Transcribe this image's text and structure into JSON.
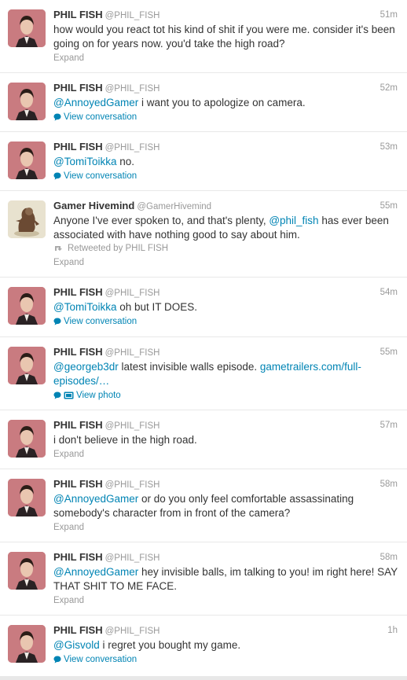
{
  "tweets": [
    {
      "kind": "phil",
      "name": "PHIL FISH",
      "handle": "@PHIL_FISH",
      "time": "51m",
      "mention": "",
      "text": "how would you react tot his kind of shit if you were me. consider it's been going on for years now. you'd take the high road?",
      "action": "Expand",
      "action_type": "expand"
    },
    {
      "kind": "phil",
      "name": "PHIL FISH",
      "handle": "@PHIL_FISH",
      "time": "52m",
      "mention": "@AnnoyedGamer",
      "text": " i want you to apologize on camera.",
      "action": "View conversation",
      "action_type": "conversation"
    },
    {
      "kind": "phil",
      "name": "PHIL FISH",
      "handle": "@PHIL_FISH",
      "time": "53m",
      "mention": "@TomiToikka",
      "text": " no.",
      "action": "View conversation",
      "action_type": "conversation"
    },
    {
      "kind": "gamer",
      "name": "Gamer Hivemind",
      "handle": "@GamerHivemind",
      "time": "55m",
      "text_before": "Anyone I've ever spoken to, and that's plenty, ",
      "inline_mention": "@phil_fish",
      "text_after": " has ever been associated with have nothing good to say about him.",
      "retweeted_by": "Retweeted by PHIL FISH",
      "action": "Expand",
      "action_type": "expand"
    },
    {
      "kind": "phil",
      "name": "PHIL FISH",
      "handle": "@PHIL_FISH",
      "time": "54m",
      "mention": "@TomiToikka",
      "text": " oh but IT DOES.",
      "action": "View conversation",
      "action_type": "conversation"
    },
    {
      "kind": "phil",
      "name": "PHIL FISH",
      "handle": "@PHIL_FISH",
      "time": "55m",
      "mention": "@georgeb3dr",
      "text": " latest invisible walls episode. ",
      "link": "gametrailers.com/full-episodes/…",
      "action": "View photo",
      "action_type": "photo"
    },
    {
      "kind": "phil",
      "name": "PHIL FISH",
      "handle": "@PHIL_FISH",
      "time": "57m",
      "mention": "",
      "text": "i don't believe in the high road.",
      "action": "Expand",
      "action_type": "expand"
    },
    {
      "kind": "phil",
      "name": "PHIL FISH",
      "handle": "@PHIL_FISH",
      "time": "58m",
      "mention": "@AnnoyedGamer",
      "text": " or do you only feel comfortable assassinating somebody's character from in front of the camera?",
      "action": "Expand",
      "action_type": "expand"
    },
    {
      "kind": "phil",
      "name": "PHIL FISH",
      "handle": "@PHIL_FISH",
      "time": "58m",
      "mention": "@AnnoyedGamer",
      "text": " hey invisible balls, im talking to you! im right here! SAY THAT SHIT TO ME FACE.",
      "action": "Expand",
      "action_type": "expand"
    },
    {
      "kind": "phil",
      "name": "PHIL FISH",
      "handle": "@PHIL_FISH",
      "time": "1h",
      "mention": "@Gisvold",
      "text": " i regret you bought my game.",
      "action": "View conversation",
      "action_type": "conversation"
    }
  ]
}
